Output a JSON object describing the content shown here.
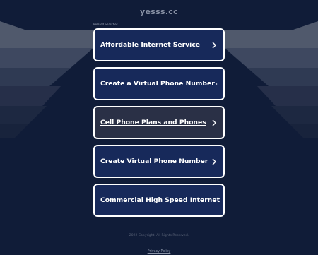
{
  "header": {
    "domain": "yesss.cc"
  },
  "related": {
    "label": "Related Searches",
    "links": [
      {
        "label": "Affordable Internet Service",
        "visited": false
      },
      {
        "label": "Create a Virtual Phone Number",
        "visited": false
      },
      {
        "label": "Cell Phone Plans and Phones",
        "visited": true
      },
      {
        "label": "Create Virtual Phone Number",
        "visited": false
      },
      {
        "label": "Commercial High Speed Internet",
        "visited": false
      }
    ]
  },
  "footer": {
    "copyright": "2022 Copyright. All Rights Reserved.",
    "privacy": "Privacy Policy"
  },
  "colors": {
    "background": "#101c38",
    "button_fill": "#17295a",
    "button_visited_fill": "#2a3046",
    "button_border": "#ffffff",
    "text": "#ffffff"
  }
}
